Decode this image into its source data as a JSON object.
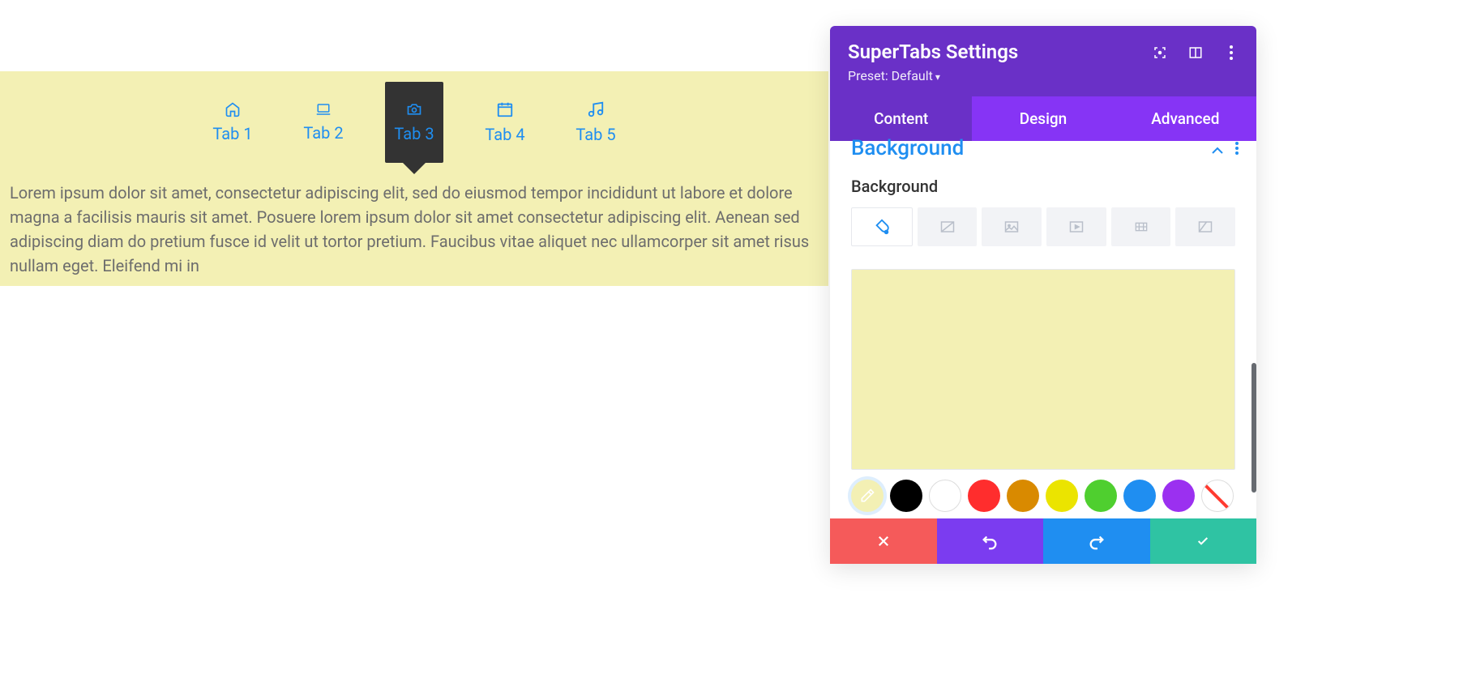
{
  "preview": {
    "tabs": [
      {
        "label": "Tab 1",
        "icon": "home-icon"
      },
      {
        "label": "Tab 2",
        "icon": "laptop-icon"
      },
      {
        "label": "Tab 3",
        "icon": "camera-icon"
      },
      {
        "label": "Tab 4",
        "icon": "calendar-icon"
      },
      {
        "label": "Tab 5",
        "icon": "music-icon"
      }
    ],
    "active_index": 2,
    "body_text": "Lorem ipsum dolor sit amet, consectetur adipiscing elit, sed do eiusmod tempor incididunt ut labore et dolore magna a facilisis mauris sit amet. Posuere lorem ipsum dolor sit amet consectetur adipiscing elit. Aenean sed adipiscing diam do pretium fusce id velit ut tortor pretium. Faucibus vitae aliquet nec ullamcorper sit amet risus nullam eget. Eleifend mi in"
  },
  "panel": {
    "title": "SuperTabs Settings",
    "preset_label": "Preset: Default",
    "tabs": {
      "content": "Content",
      "design": "Design",
      "advanced": "Advanced"
    },
    "active_tab": "content",
    "section_title": "Background",
    "subheader": "Background",
    "bg_types": [
      "color",
      "gradient",
      "image",
      "video",
      "pattern",
      "mask"
    ],
    "bg_type_active": "color",
    "current_color": "#f3f0b4",
    "swatches": [
      "#f3f0b4",
      "#000000",
      "#ffffff",
      "#ff2d2d",
      "#d98a00",
      "#ebe400",
      "#4fcf2f",
      "#1f8ef1",
      "#9b30f0",
      "none"
    ],
    "footer": {
      "close": "close",
      "undo": "undo",
      "redo": "redo",
      "ok": "confirm"
    }
  }
}
